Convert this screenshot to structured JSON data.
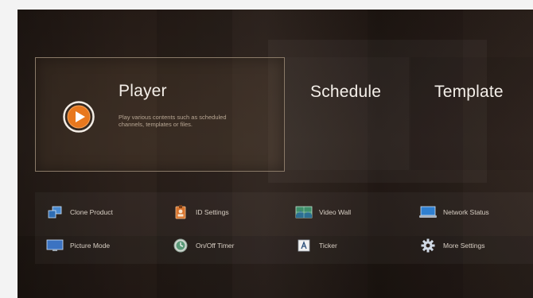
{
  "tiles": {
    "player": {
      "title": "Player",
      "description": "Play various contents such as scheduled channels, templates or files."
    },
    "schedule": {
      "title": "Schedule"
    },
    "template": {
      "title": "Template"
    }
  },
  "settings": [
    {
      "label": "Clone Product",
      "icon": "clone-product-icon"
    },
    {
      "label": "ID Settings",
      "icon": "id-settings-icon"
    },
    {
      "label": "Video Wall",
      "icon": "video-wall-icon"
    },
    {
      "label": "Network Status",
      "icon": "network-status-icon"
    },
    {
      "label": "Picture Mode",
      "icon": "picture-mode-icon"
    },
    {
      "label": "On/Off Timer",
      "icon": "on-off-timer-icon"
    },
    {
      "label": "Ticker",
      "icon": "ticker-icon"
    },
    {
      "label": "More Settings",
      "icon": "more-settings-icon"
    }
  ],
  "colors": {
    "accent": "#e8781e",
    "background": "#2a1f1a",
    "focus_border": "#8a7a68"
  }
}
